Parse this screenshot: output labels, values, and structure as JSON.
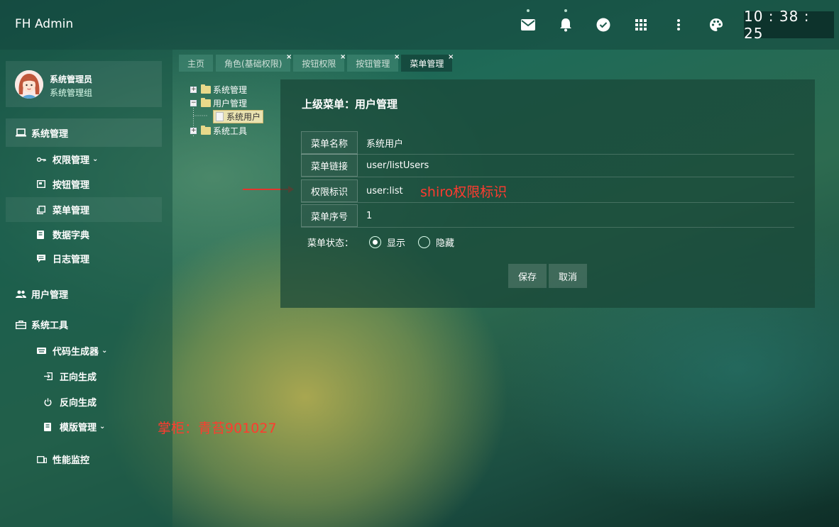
{
  "header": {
    "app_title": "FH Admin",
    "clock": "10 : 38 : 25",
    "icons": [
      "mail-icon",
      "bell-icon",
      "check-circle-icon",
      "apps-icon",
      "more-vert-icon",
      "palette-icon"
    ]
  },
  "user": {
    "name": "系统管理员",
    "group": "系统管理组"
  },
  "sidebar": {
    "system_mgmt": "系统管理",
    "permission_mgmt": "权限管理",
    "button_mgmt": "按钮管理",
    "menu_mgmt": "菜单管理",
    "data_dict": "数据字典",
    "log_mgmt": "日志管理",
    "user_mgmt": "用户管理",
    "system_tools": "系统工具",
    "code_gen": "代码生成器",
    "forward_gen": "正向生成",
    "reverse_gen": "反向生成",
    "template_mgmt": "模版管理",
    "perf_monitor": "性能监控"
  },
  "tabs": [
    "主页",
    "角色(基础权限)",
    "按钮权限",
    "按钮管理",
    "菜单管理"
  ],
  "tree": {
    "system_mgmt": "系统管理",
    "user_mgmt": "用户管理",
    "system_user": "系统用户",
    "system_tools": "系统工具"
  },
  "form": {
    "title": "上级菜单：用户管理",
    "name_label": "菜单名称",
    "name_value": "系统用户",
    "link_label": "菜单链接",
    "link_value": "user/listUsers",
    "perm_label": "权限标识",
    "perm_value": "user:list",
    "order_label": "菜单序号",
    "order_value": "1",
    "status_label": "菜单状态：",
    "status_show": "显示",
    "status_hide": "隐藏",
    "status_selected": "显示",
    "save_label": "保存",
    "cancel_label": "取消"
  },
  "annotations": {
    "shiro_note": "shiro权限标识",
    "watermark": "掌柜：青苔901027"
  },
  "colors": {
    "annotation": "#ff3b2f"
  }
}
